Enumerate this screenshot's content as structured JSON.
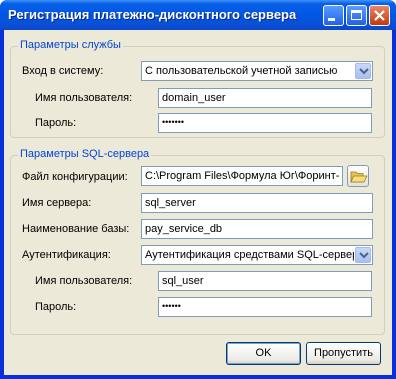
{
  "window": {
    "title": "Регистрация платежно-дисконтного сервера"
  },
  "service": {
    "legend": "Параметры службы",
    "login_label": "Вход в систему:",
    "login_value": "С пользовательской учетной записью",
    "user_label": "Имя пользователя:",
    "user_value": "domain_user",
    "password_label": "Пароль:",
    "password_value": "•••••••"
  },
  "sql": {
    "legend": "Параметры SQL-сервера",
    "config_label": "Файл конфигурации:",
    "config_value": "C:\\Program Files\\Формула Юг\\Форинт-",
    "server_label": "Имя сервера:",
    "server_value": "sql_server",
    "db_label": "Наименование базы:",
    "db_value": "pay_service_db",
    "auth_label": "Аутентификация:",
    "auth_value": "Аутентификация средствами SQL-сервер",
    "user_label": "Имя пользователя:",
    "user_value": "sql_user",
    "password_label": "Пароль:",
    "password_value": "••••••"
  },
  "buttons": {
    "ok": "OK",
    "skip": "Пропустить"
  },
  "colors": {
    "titlebar": "#0058e6",
    "group_legend": "#0046d5",
    "dialog_bg": "#ece9d8",
    "close_button": "#c2390f"
  }
}
